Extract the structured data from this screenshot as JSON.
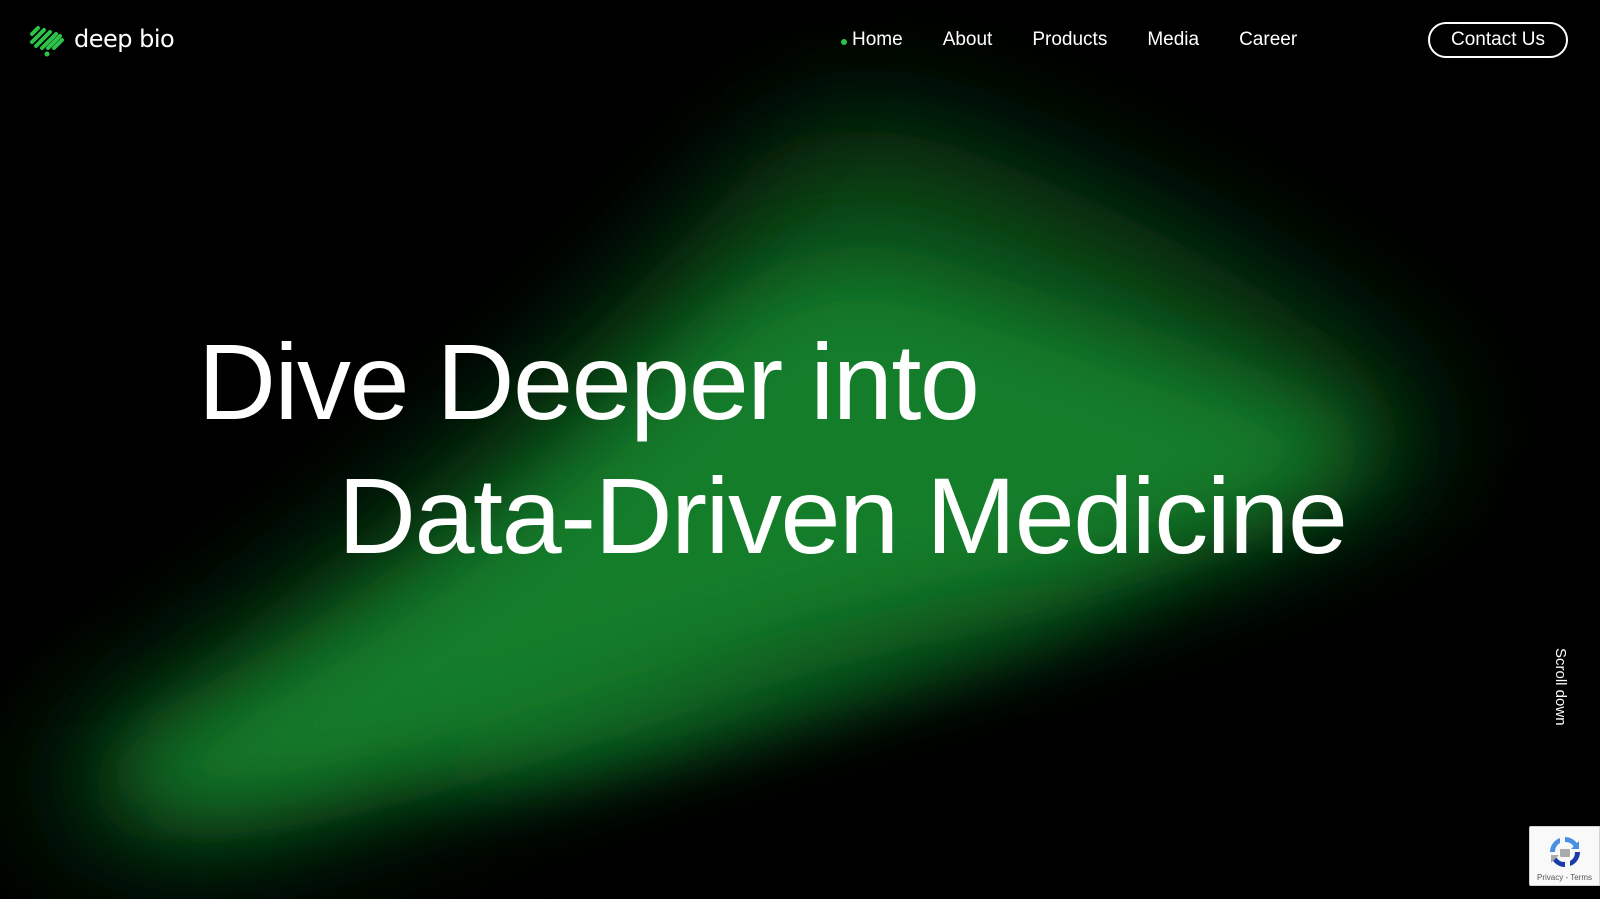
{
  "brand": {
    "name": "deep bio",
    "logo_icon": "deepbio-logo-icon",
    "accent_color": "#2ec24a"
  },
  "nav": {
    "items": [
      {
        "label": "Home",
        "active": true
      },
      {
        "label": "About",
        "active": false
      },
      {
        "label": "Products",
        "active": false
      },
      {
        "label": "Media",
        "active": false
      },
      {
        "label": "Career",
        "active": false
      }
    ],
    "contact_label": "Contact Us"
  },
  "hero": {
    "headline_line1": "Dive Deeper into",
    "headline_line2": "Data-Driven Medicine",
    "background_color": "#000000",
    "glow_color": "#1fa83a"
  },
  "scroll_hint": "Scroll down",
  "recaptcha": {
    "icon": "recaptcha-icon",
    "privacy_label": "Privacy",
    "separator": "-",
    "terms_label": "Terms"
  }
}
